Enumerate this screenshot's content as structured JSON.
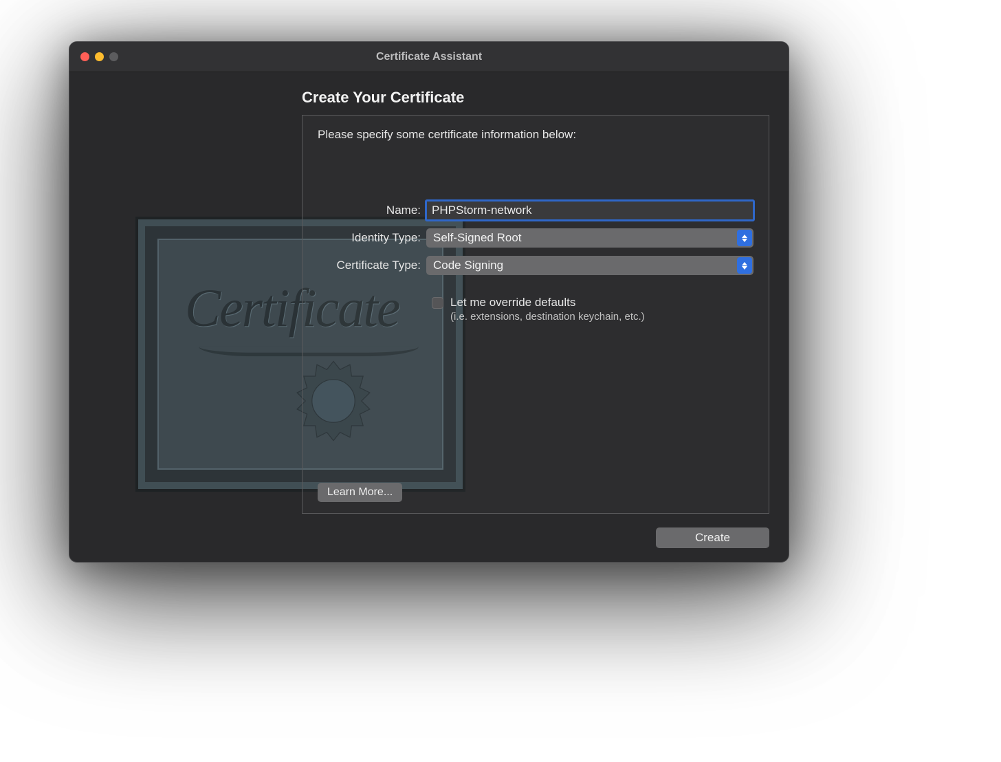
{
  "window": {
    "title": "Certificate Assistant"
  },
  "heading": "Create Your Certificate",
  "panel": {
    "instruction": "Please specify some certificate information below:",
    "fields": {
      "name_label": "Name:",
      "name_value": "PHPStorm-network",
      "identity_label": "Identity Type:",
      "identity_value": "Self-Signed Root",
      "cert_type_label": "Certificate Type:",
      "cert_type_value": "Code Signing"
    },
    "override": {
      "label": "Let me override defaults",
      "sub": "(i.e. extensions, destination keychain, etc.)"
    },
    "learn_more": "Learn More..."
  },
  "buttons": {
    "create": "Create"
  },
  "illustration": {
    "script_text": "Certificate"
  }
}
